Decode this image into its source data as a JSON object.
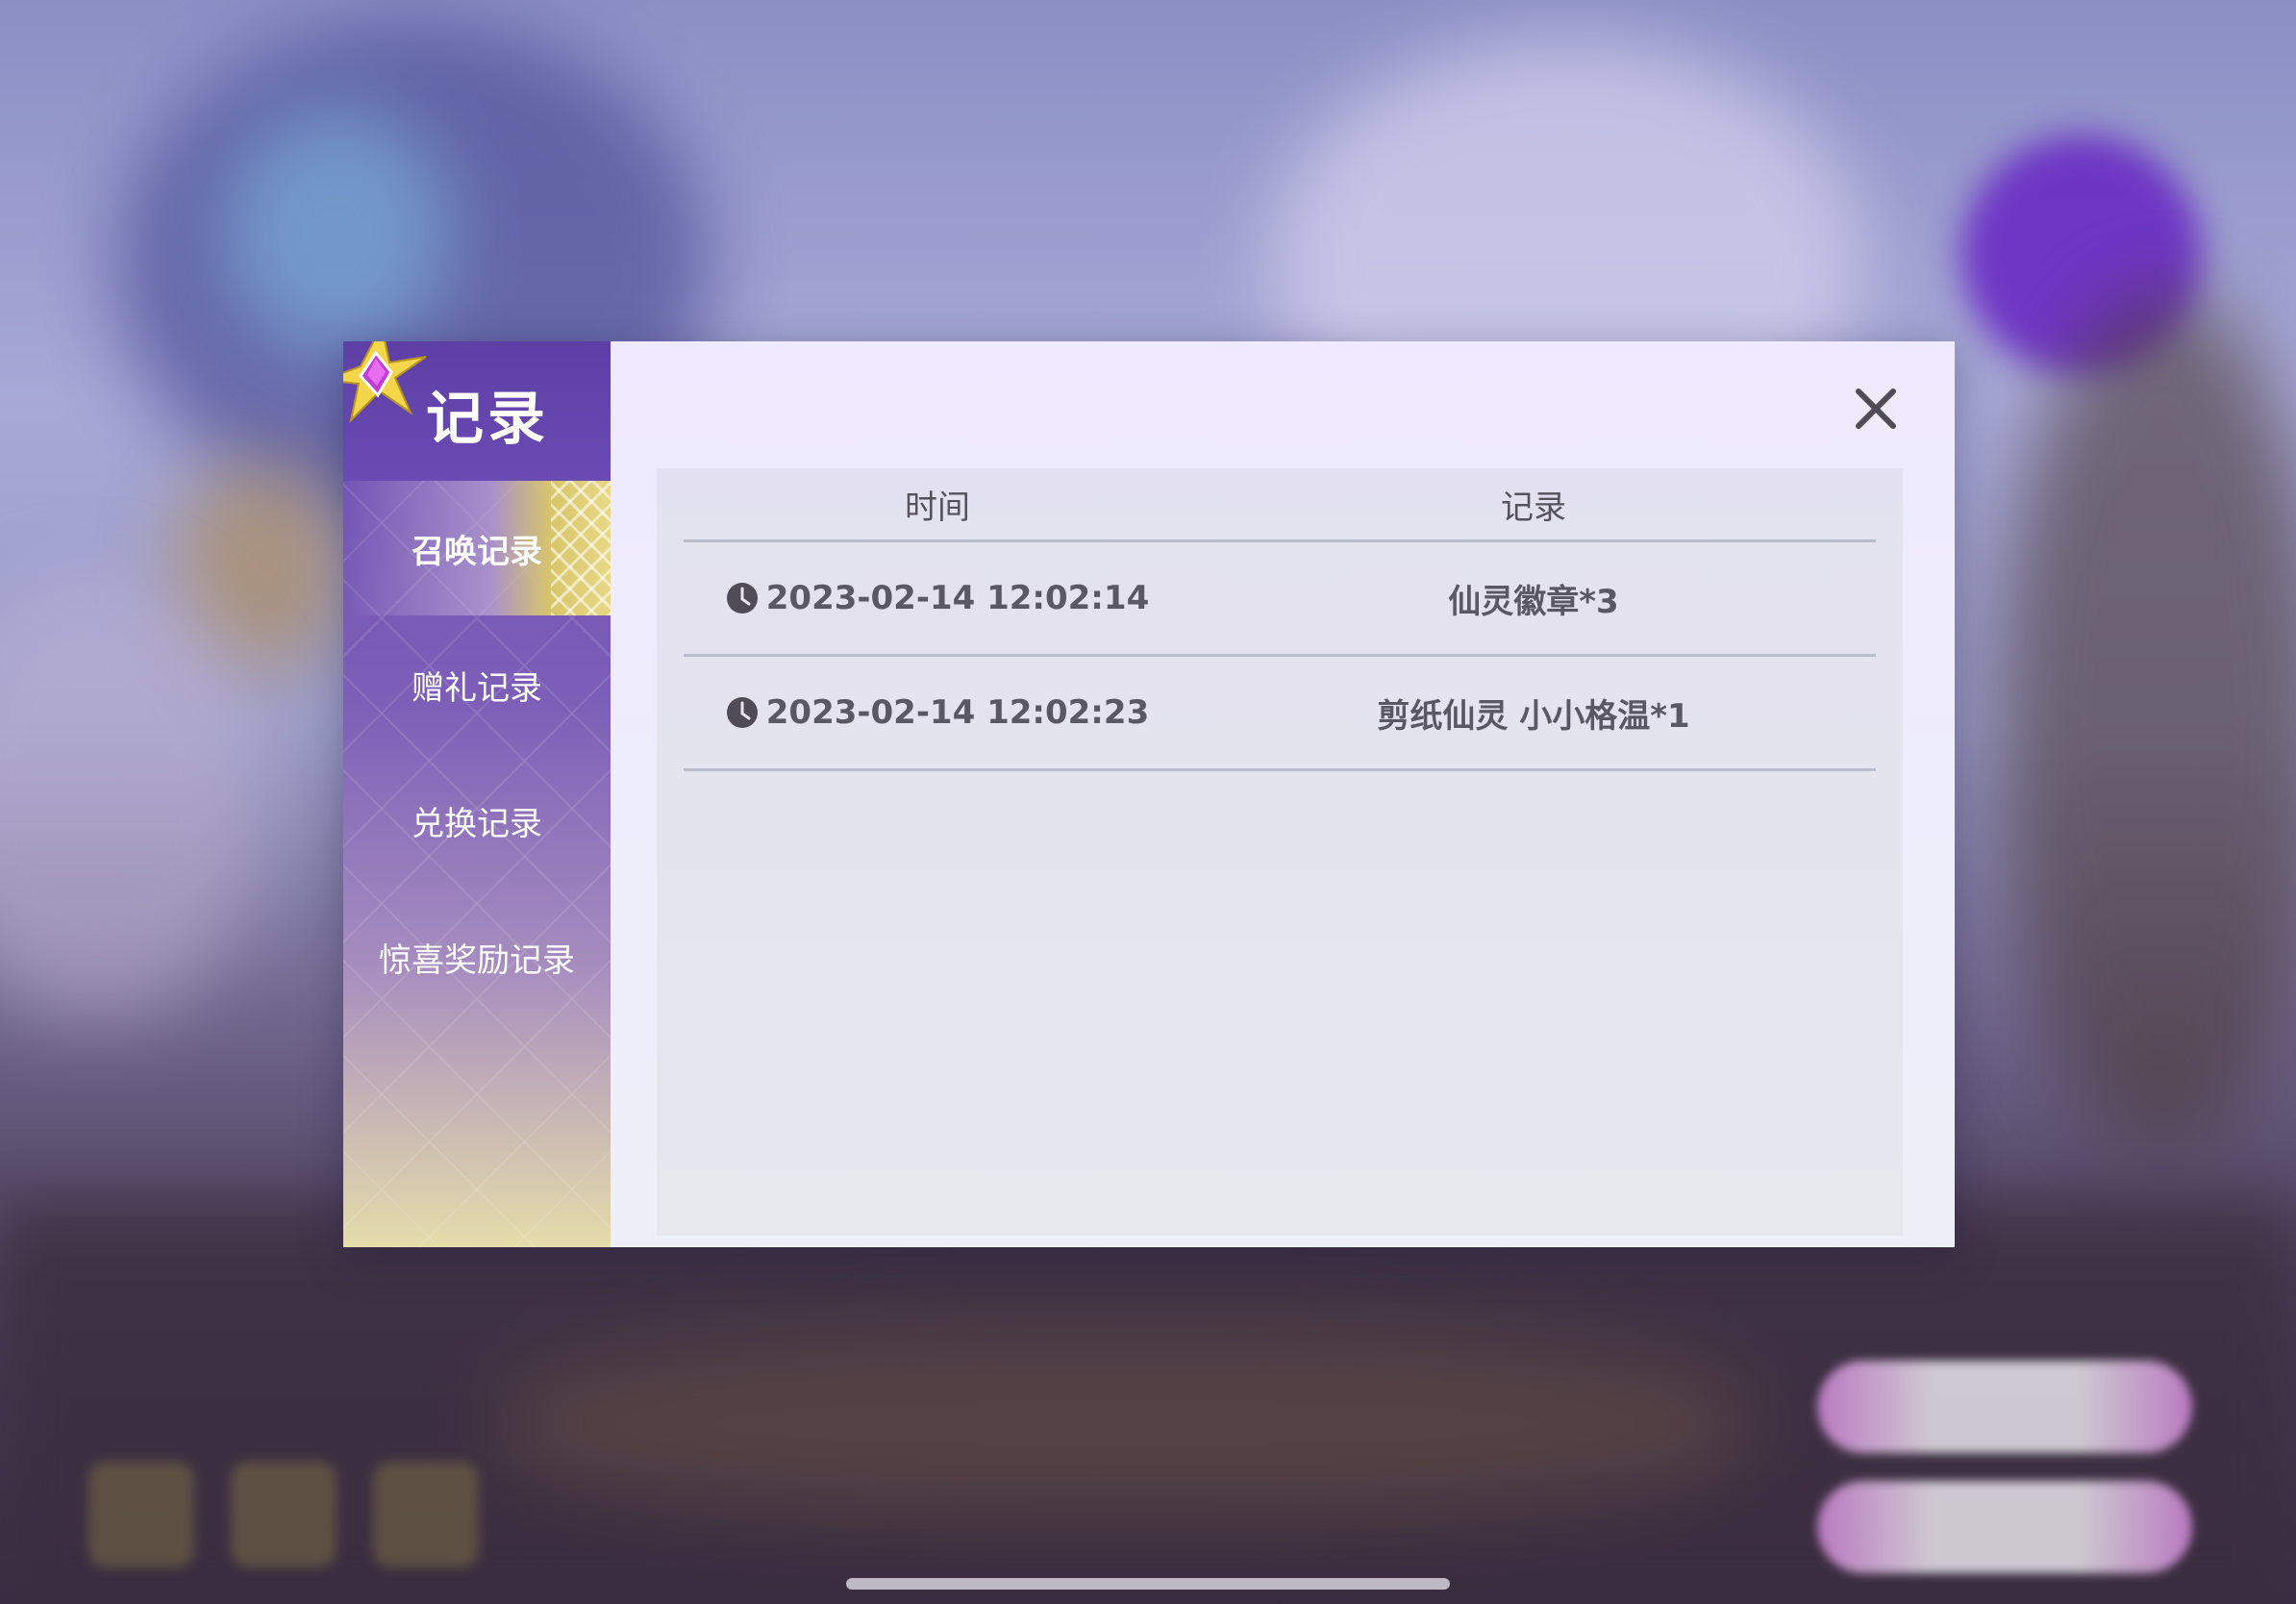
{
  "dialog": {
    "title": "记录",
    "close_label": "✕"
  },
  "sidebar": {
    "items": [
      {
        "label": "召唤记录",
        "active": true
      },
      {
        "label": "赠礼记录",
        "active": false
      },
      {
        "label": "兑换记录",
        "active": false
      },
      {
        "label": "惊喜奖励记录",
        "active": false
      }
    ]
  },
  "table": {
    "headers": {
      "time": "时间",
      "record": "记录"
    },
    "rows": [
      {
        "time": "2023-02-14 12:02:14",
        "record": "仙灵徽章*3"
      },
      {
        "time": "2023-02-14 12:02:23",
        "record": "剪纸仙灵 小小格温*1"
      }
    ]
  },
  "icons": {
    "logo": "star-gem-icon",
    "close": "close-icon",
    "row_time": "clock-icon"
  },
  "colors": {
    "sidebar_top": "#5d3fa6",
    "sidebar_bottom": "#e5dcaa",
    "active_accent": "#d8c66a",
    "panel_bg": "#efeaff",
    "text": "#5b5866"
  }
}
